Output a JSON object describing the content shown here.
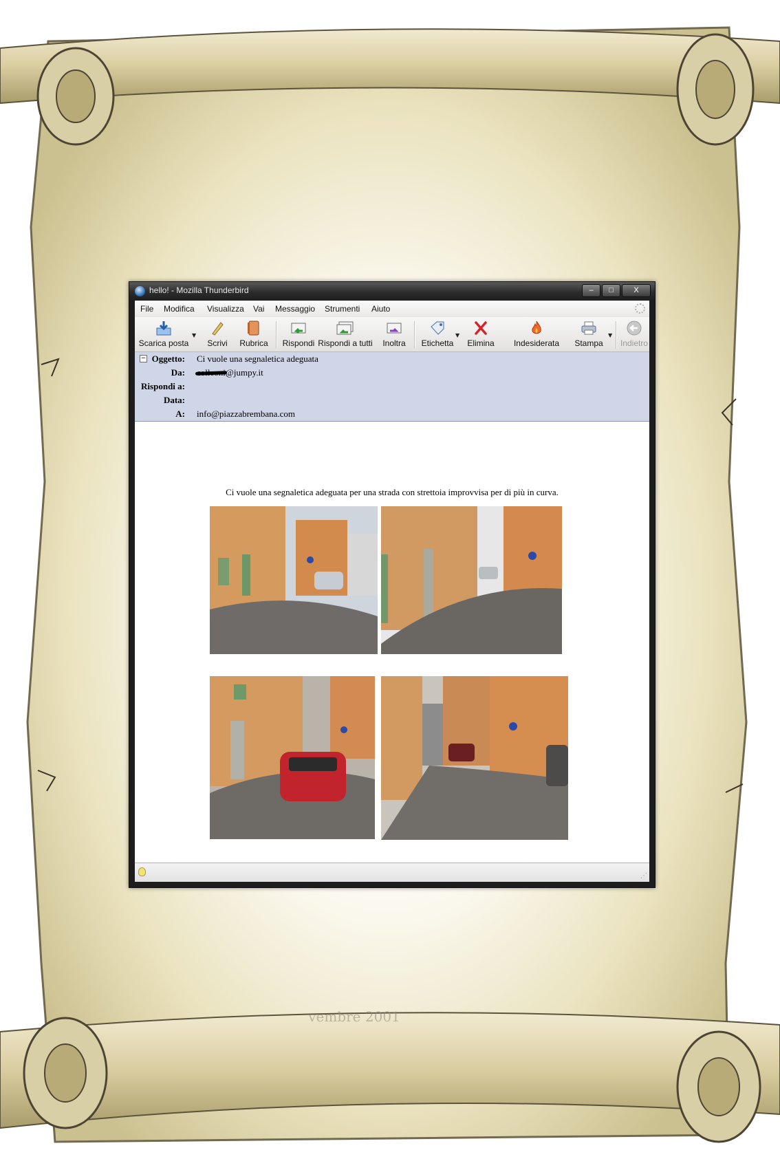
{
  "window": {
    "title": "hello! - Mozilla Thunderbird",
    "controls": {
      "minimize": "–",
      "maximize": "□",
      "close": "X"
    }
  },
  "menu": [
    "File",
    "Modifica",
    "Visualizza",
    "Vai",
    "Messaggio",
    "Strumenti",
    "Aiuto"
  ],
  "toolbar": {
    "get_mail": "Scarica posta",
    "write": "Scrivi",
    "address_book": "Rubrica",
    "reply": "Rispondi",
    "reply_all": "Rispondi a tutti",
    "forward": "Inoltra",
    "tag": "Etichetta",
    "delete": "Elimina",
    "junk": "Indesiderata",
    "print": "Stampa",
    "back": "Indietro"
  },
  "header": {
    "subject_label": "Oggetto:",
    "subject": "Ci vuole una segnaletica adeguata",
    "from_label": "Da:",
    "from_redacted": "colleoni",
    "from_domain": "@jumpy.it",
    "reply_to_label": "Rispondi a:",
    "date_label": "Data:",
    "to_label": "A:",
    "to": "info@piazzabrembana.com"
  },
  "body": {
    "text": "Ci vuole una segnaletica adeguata per una strada  con strettoia improvvisa per di più in curva."
  },
  "background": {
    "caption": "vembre 2001"
  },
  "colors": {
    "header_bg": "#cfd6e8",
    "window_frame": "#1d1d1d",
    "parchment": "#e8dfb8"
  }
}
